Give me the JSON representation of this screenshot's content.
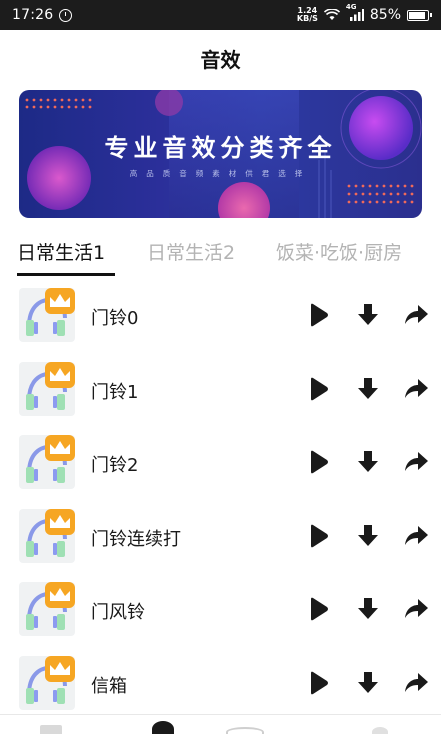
{
  "status_bar": {
    "time": "17:26",
    "net_speed_value": "1.24",
    "net_speed_unit": "KB/S",
    "network_type": "4G",
    "battery": "85%"
  },
  "page": {
    "title": "音效"
  },
  "banner": {
    "title": "专业音效分类齐全",
    "subtitle": "高品质音频素材供君选择"
  },
  "tabs": [
    {
      "label": "日常生活1",
      "active": true
    },
    {
      "label": "日常生活2",
      "active": false
    },
    {
      "label": "饭菜·吃饭·厨房",
      "active": false
    }
  ],
  "sounds": [
    {
      "label": "门铃0"
    },
    {
      "label": "门铃1"
    },
    {
      "label": "门铃2"
    },
    {
      "label": "门铃连续打"
    },
    {
      "label": "门风铃"
    },
    {
      "label": "信箱"
    }
  ],
  "icons": {
    "play": "play-icon",
    "download": "download-icon",
    "share": "share-icon",
    "thumbnail": "headphones-crown-icon"
  },
  "colors": {
    "status_bar": "#1c1c1c",
    "banner_bg": "#2b2f9a",
    "crown_badge": "#f6a623",
    "icon_dark": "#1a1a1a",
    "inactive_tab": "#b3b3b3"
  }
}
